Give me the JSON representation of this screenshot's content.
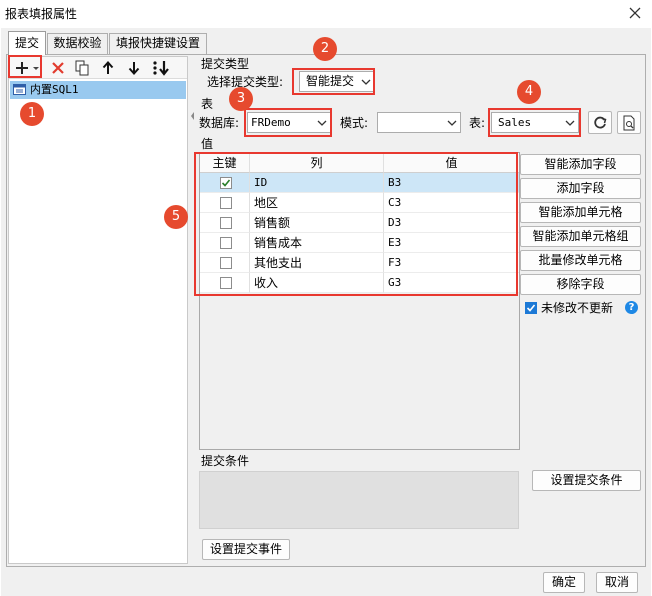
{
  "window": {
    "title": "报表填报属性"
  },
  "tabs": [
    "提交",
    "数据校验",
    "填报快捷键设置"
  ],
  "left_panel": {
    "items": [
      "内置SQL1"
    ]
  },
  "submit_type": {
    "section": "提交类型",
    "label": "选择提交类型:",
    "value": "智能提交"
  },
  "table_section": {
    "section": "表",
    "db_label": "数据库:",
    "db_value": "FRDemo",
    "mode_label": "模式:",
    "mode_value": "",
    "table_label": "表:",
    "table_value": "Sales"
  },
  "values_section": {
    "section": "值",
    "headers": [
      "主键",
      "列",
      "值"
    ],
    "rows": [
      {
        "key": true,
        "column": "ID",
        "value": "B3"
      },
      {
        "key": false,
        "column": "地区",
        "value": "C3"
      },
      {
        "key": false,
        "column": "销售额",
        "value": "D3"
      },
      {
        "key": false,
        "column": "销售成本",
        "value": "E3"
      },
      {
        "key": false,
        "column": "其他支出",
        "value": "F3"
      },
      {
        "key": false,
        "column": "收入",
        "value": "G3"
      }
    ]
  },
  "side_buttons": [
    "智能添加字段",
    "添加字段",
    "智能添加单元格",
    "智能添加单元格组",
    "批量修改单元格",
    "移除字段"
  ],
  "no_update": {
    "label": "未修改不更新",
    "checked": true
  },
  "condition": {
    "section": "提交条件",
    "button": "设置提交条件"
  },
  "event_button": "设置提交事件",
  "footer": {
    "ok": "确定",
    "cancel": "取消"
  },
  "badges": [
    "1",
    "2",
    "3",
    "4",
    "5"
  ],
  "colors": {
    "accent_red": "#e8382f",
    "badge": "#e64a2e",
    "selection": "#99c9ef",
    "row_selected": "#cde6f7",
    "help": "#1e88e5"
  }
}
